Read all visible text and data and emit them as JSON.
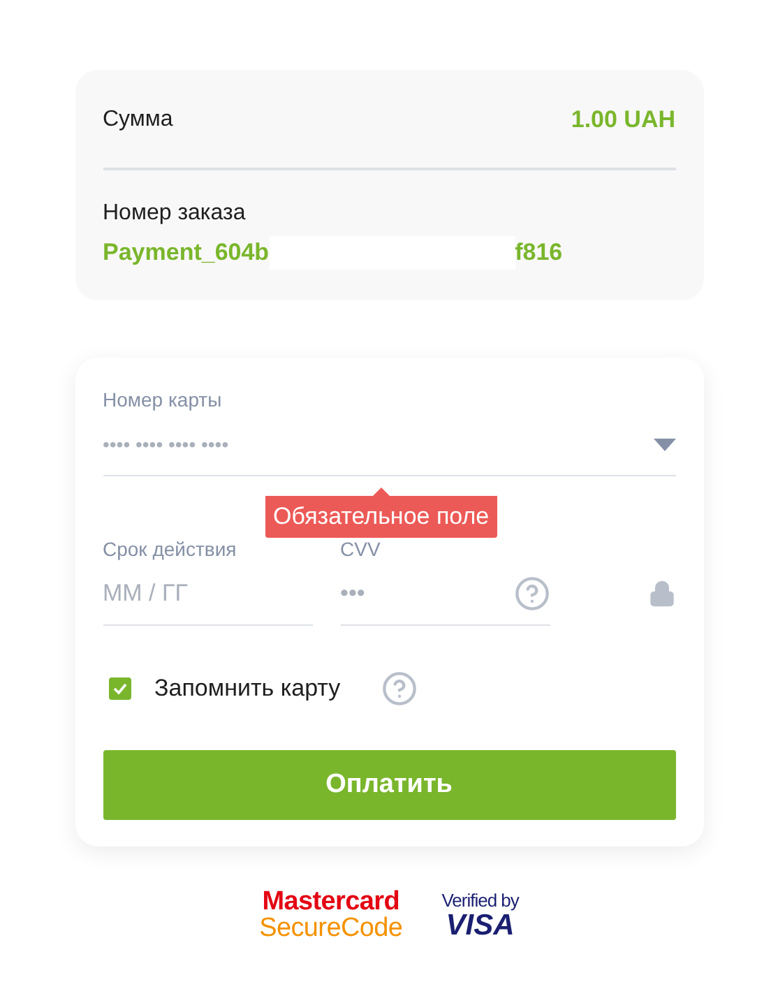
{
  "summary": {
    "amount_label": "Сумма",
    "amount": "1.00 UAH",
    "order_label": "Номер заказа",
    "order_number_start": "Payment_604b",
    "order_number_end": "f816"
  },
  "form": {
    "card_number": {
      "label": "Номер карты",
      "placeholder": "•••• •••• •••• ••••"
    },
    "error_tooltip": "Обязательное поле",
    "expiry": {
      "label": "Срок действия",
      "placeholder": "ММ / ГГ"
    },
    "cvv": {
      "label": "CVV",
      "placeholder": "•••"
    },
    "remember_card": {
      "label": "Запомнить карту",
      "checked": true
    },
    "pay_button": "Оплатить"
  },
  "badges": [
    {
      "kind": "mastercard",
      "line1": "Mastercard",
      "line2": "SecureCode"
    },
    {
      "kind": "visa",
      "line1": "Verified by",
      "line2": "VISA"
    }
  ]
}
